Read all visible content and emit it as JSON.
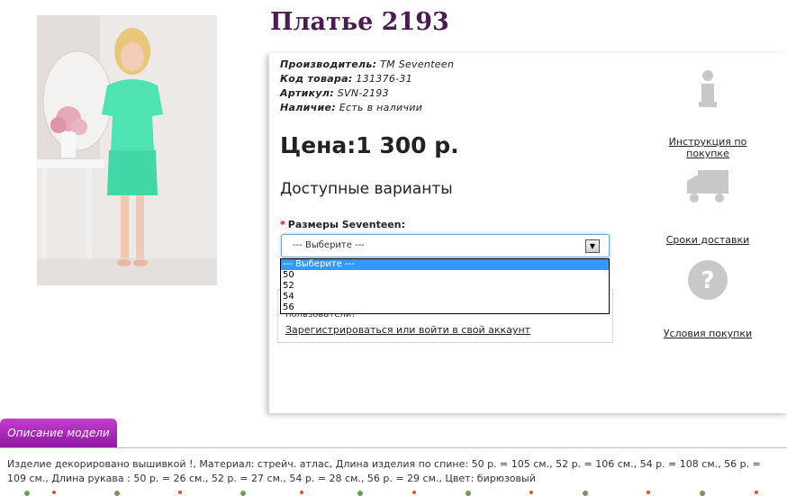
{
  "product": {
    "title": "Платье 2193",
    "image_alt": "Seventeen dress photo"
  },
  "specs": [
    {
      "key": "Производитель:",
      "value": "ТМ Seventeen"
    },
    {
      "key": "Код товара:",
      "value": "131376-31"
    },
    {
      "key": "Артикул:",
      "value": "SVN-2193"
    },
    {
      "key": "Наличие:",
      "value": "Есть в наличии"
    }
  ],
  "price": "Цена:1 300 р.",
  "variants": {
    "title": "Доступные варианты",
    "size_label": "Размеры Seventeen:",
    "required_mark": "*",
    "selected": "--- Выберите ---",
    "options": [
      "--- Выберите ---",
      "50",
      "52",
      "54",
      "56"
    ]
  },
  "login": {
    "text": "пользователи!",
    "link": "Зарегистрироваться или войти в свой аккаунт"
  },
  "side_links": {
    "instruction": "Инструкция по покупке",
    "delivery": "Сроки доставки",
    "terms": "Условия покупки"
  },
  "icons": {
    "info": "info-icon",
    "truck": "truck-icon",
    "question": "question-icon"
  },
  "colors": {
    "title": "#4b1c4f",
    "tab": "#a628b8",
    "dress": "#4fe3b3",
    "icon_gray": "#c8c8c8"
  },
  "tab": {
    "label": "Описание модели"
  },
  "description": "Изделие декорировано вышивкой !, Материал: стрейч. атлас, Длина изделия по спине: 50 р. = 105 см., 52 р. = 106 см., 54 р. = 108 см., 56 р. = 109 см., Длина рукава : 50 р. = 26 см., 52 р. = 27 см., 54 р. = 28 см., 56 р. = 29 см., Цвет: бирюзовый"
}
